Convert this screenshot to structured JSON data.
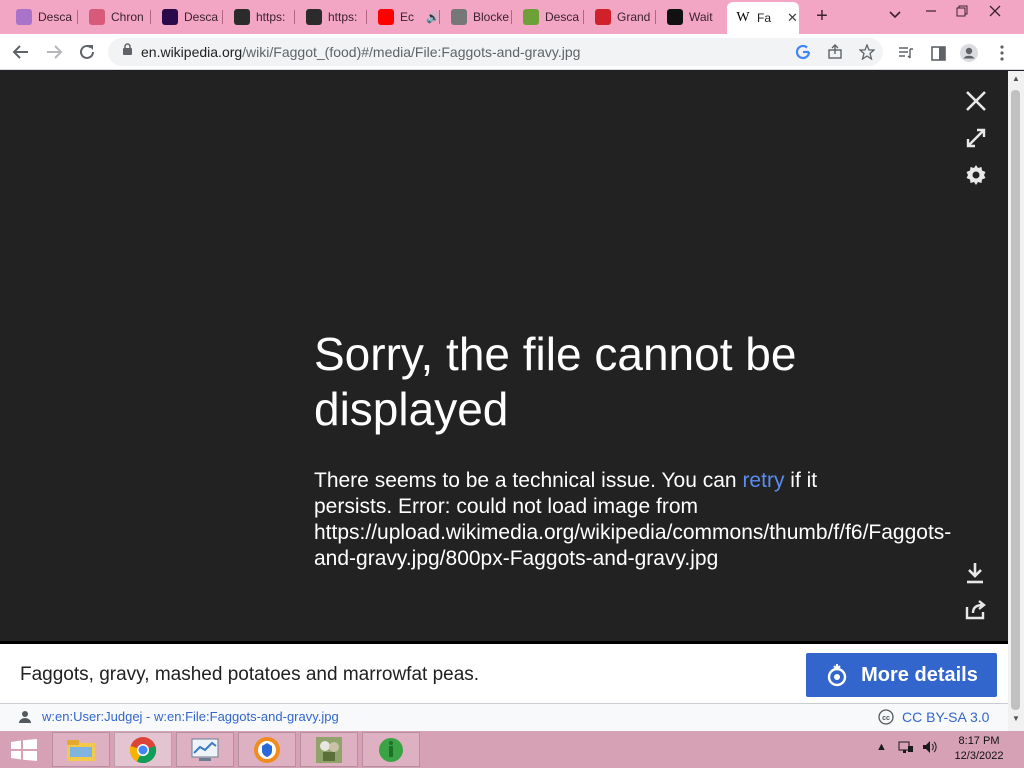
{
  "browser": {
    "tabs": [
      {
        "title": "Desca",
        "favicon": "checkmark-icon",
        "color": "#a873c9"
      },
      {
        "title": "Chron",
        "favicon": "gift-icon",
        "color": "#d75a7a"
      },
      {
        "title": "Desca",
        "favicon": "after-effects-icon",
        "color": "#2a0a4a"
      },
      {
        "title": "https:",
        "favicon": "photo-icon",
        "color": "#2b2b2b"
      },
      {
        "title": "https:",
        "favicon": "photo-icon",
        "color": "#2b2b2b"
      },
      {
        "title": "Ec",
        "favicon": "youtube-icon",
        "color": "#ff0000",
        "audio": "speaker-icon"
      },
      {
        "title": "Blocke",
        "favicon": "globe-icon",
        "color": "#777777"
      },
      {
        "title": "Desca",
        "favicon": "game-icon",
        "color": "#6ea03a"
      },
      {
        "title": "Grand",
        "favicon": "gamepad-icon",
        "color": "#d0202a"
      },
      {
        "title": "Wait",
        "favicon": "ipc-icon",
        "color": "#111111"
      }
    ],
    "active_tab": {
      "title": "Fa",
      "favicon_text": "W"
    },
    "new_tab_label": "+",
    "url_domain": "en.wikipedia.org",
    "url_path": "/wiki/Faggot_(food)#/media/File:Faggots-and-gravy.jpg"
  },
  "viewer": {
    "error_title": "Sorry, the file cannot be displayed",
    "error_text_before": "There seems to be a technical issue. You can ",
    "retry_label": "retry",
    "error_text_after": " if it persists. Error: could not load image from https://upload.wikimedia.org/wikipedia/commons/thumb/f/f6/Faggots-and-gravy.jpg/800px-Faggots-and-gravy.jpg"
  },
  "footer": {
    "caption": "Faggots, gravy, mashed potatoes and marrowfat peas.",
    "more_details_label": "More details",
    "author": "w:en:User:Judgej - w:en:File:Faggots-and-gravy.jpg",
    "license": "CC BY-SA 3.0"
  },
  "taskbar": {
    "apps": [
      "file-explorer-icon",
      "chrome-icon",
      "system-monitor-icon",
      "avast-browser-icon",
      "plants-vs-zombies-icon",
      "green-app-icon"
    ],
    "time": "8:17 PM",
    "date": "12/3/2022"
  },
  "colors": {
    "tabstrip": "#f2a6c4",
    "viewer_bg": "#222222",
    "link": "#3366cc",
    "taskbar": "#d6a0b5"
  }
}
